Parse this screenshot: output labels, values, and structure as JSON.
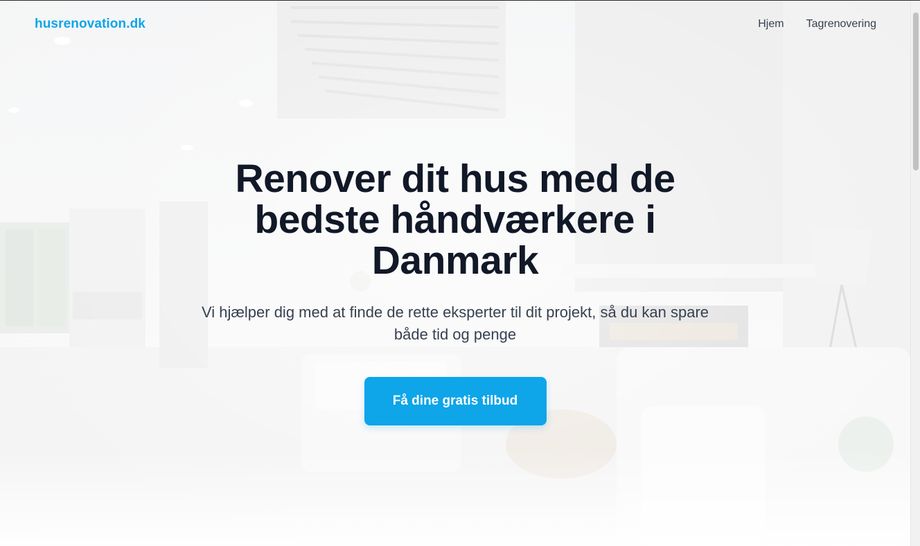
{
  "header": {
    "logo": "husrenovation.dk",
    "nav": [
      {
        "label": "Hjem"
      },
      {
        "label": "Tagrenovering"
      }
    ]
  },
  "hero": {
    "title": "Renover dit hus med de bedste håndværkere i Danmark",
    "subtitle": "Vi hjælper dig med at finde de rette eksperter til dit projekt, så du kan spare både tid og penge",
    "cta_label": "Få dine gratis tilbud",
    "background_image": "faded-living-room-interior-photo"
  },
  "colors": {
    "brand": "#0ea5e9",
    "title": "#111827",
    "body_text": "#374151",
    "cta_text": "#ffffff"
  }
}
